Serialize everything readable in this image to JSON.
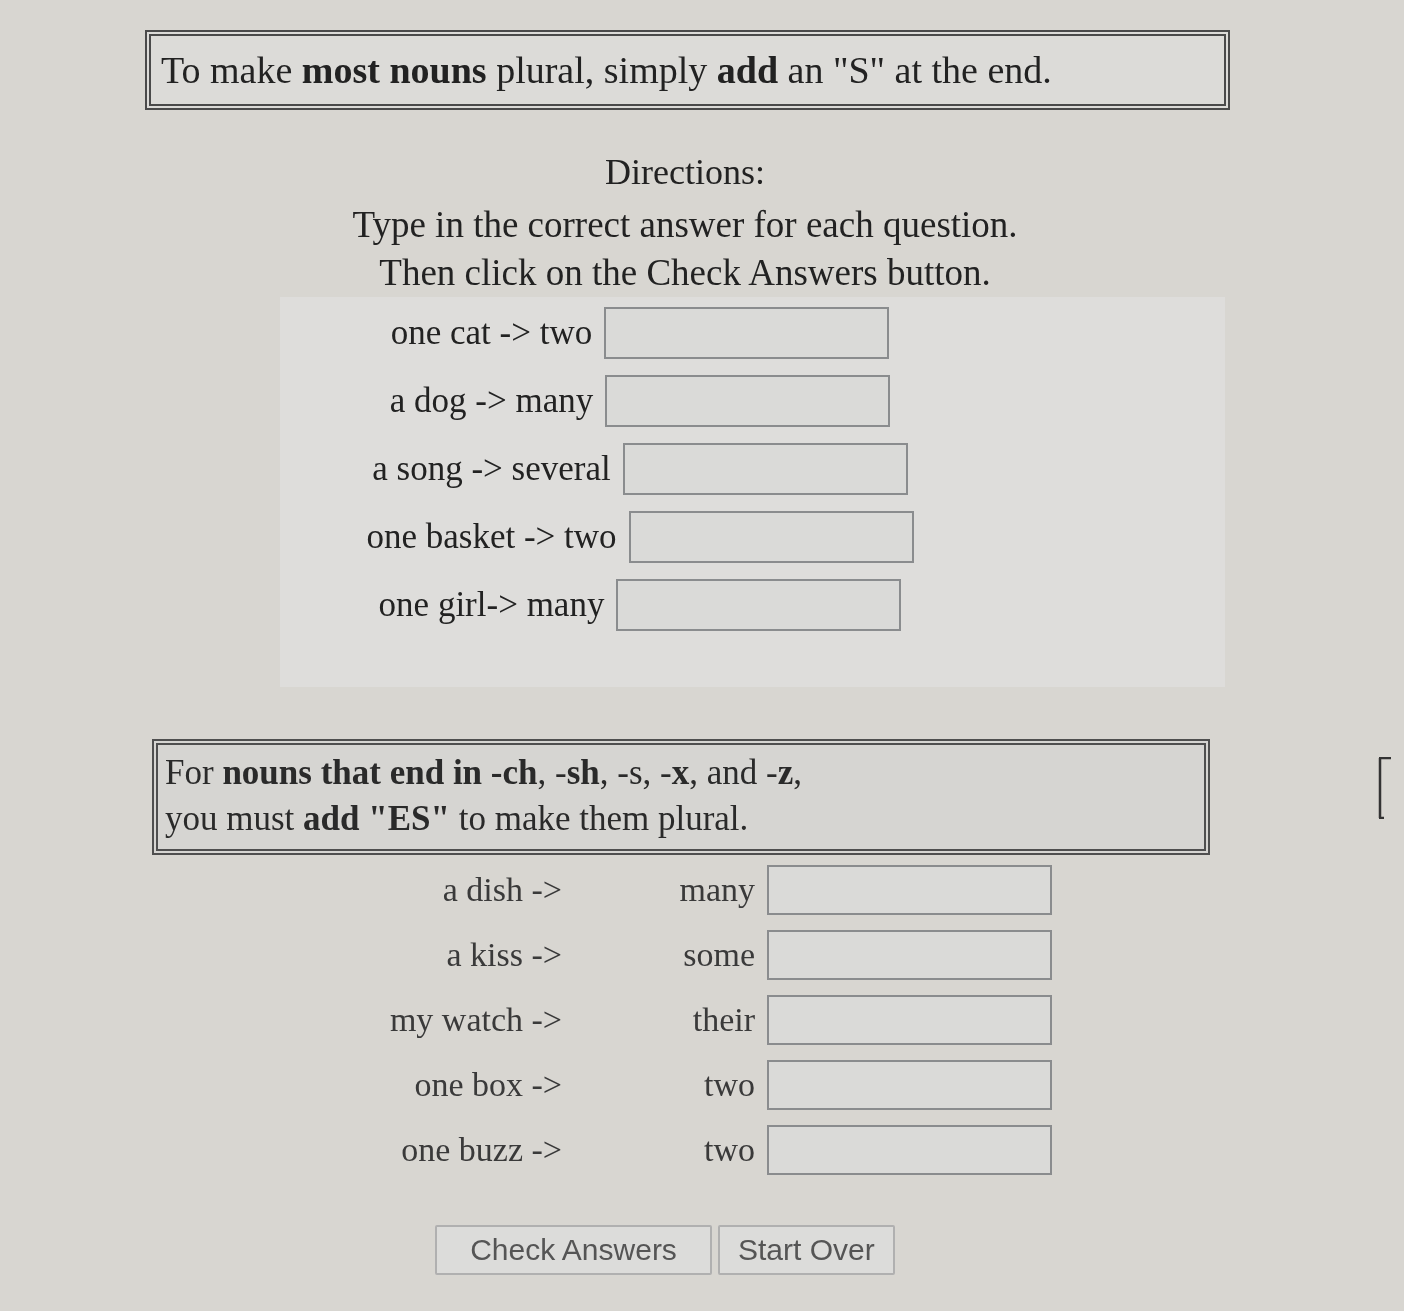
{
  "rule_box": {
    "text": "To make **most nouns** plural, simply **add** an \"S\" at the end."
  },
  "directions": {
    "heading": "Directions:",
    "lines": [
      "Type in the correct answer for each question.",
      "Then click on the Check Answers button."
    ]
  },
  "questions": [
    {
      "prompt": "one cat -> two"
    },
    {
      "prompt": "a dog -> many"
    },
    {
      "prompt": "a song -> several"
    },
    {
      "prompt": "one basket -> two"
    },
    {
      "prompt": "one girl-> many"
    }
  ],
  "es_rule_box": {
    "lines": [
      "For **nouns that end in -ch**, -**sh**, -s, -**x**, and -**z**,",
      "you must **add \"ES\"** to make them plural."
    ]
  },
  "es_questions": [
    {
      "singular": "a dish ->",
      "plural_word": "many"
    },
    {
      "singular": "a kiss ->",
      "plural_word": "some"
    },
    {
      "singular": "my watch ->",
      "plural_word": "their"
    },
    {
      "singular": "one box ->",
      "plural_word": "two"
    },
    {
      "singular": "one buzz ->",
      "plural_word": "two"
    }
  ],
  "buttons": [
    "Check Answers",
    "Start Over"
  ]
}
